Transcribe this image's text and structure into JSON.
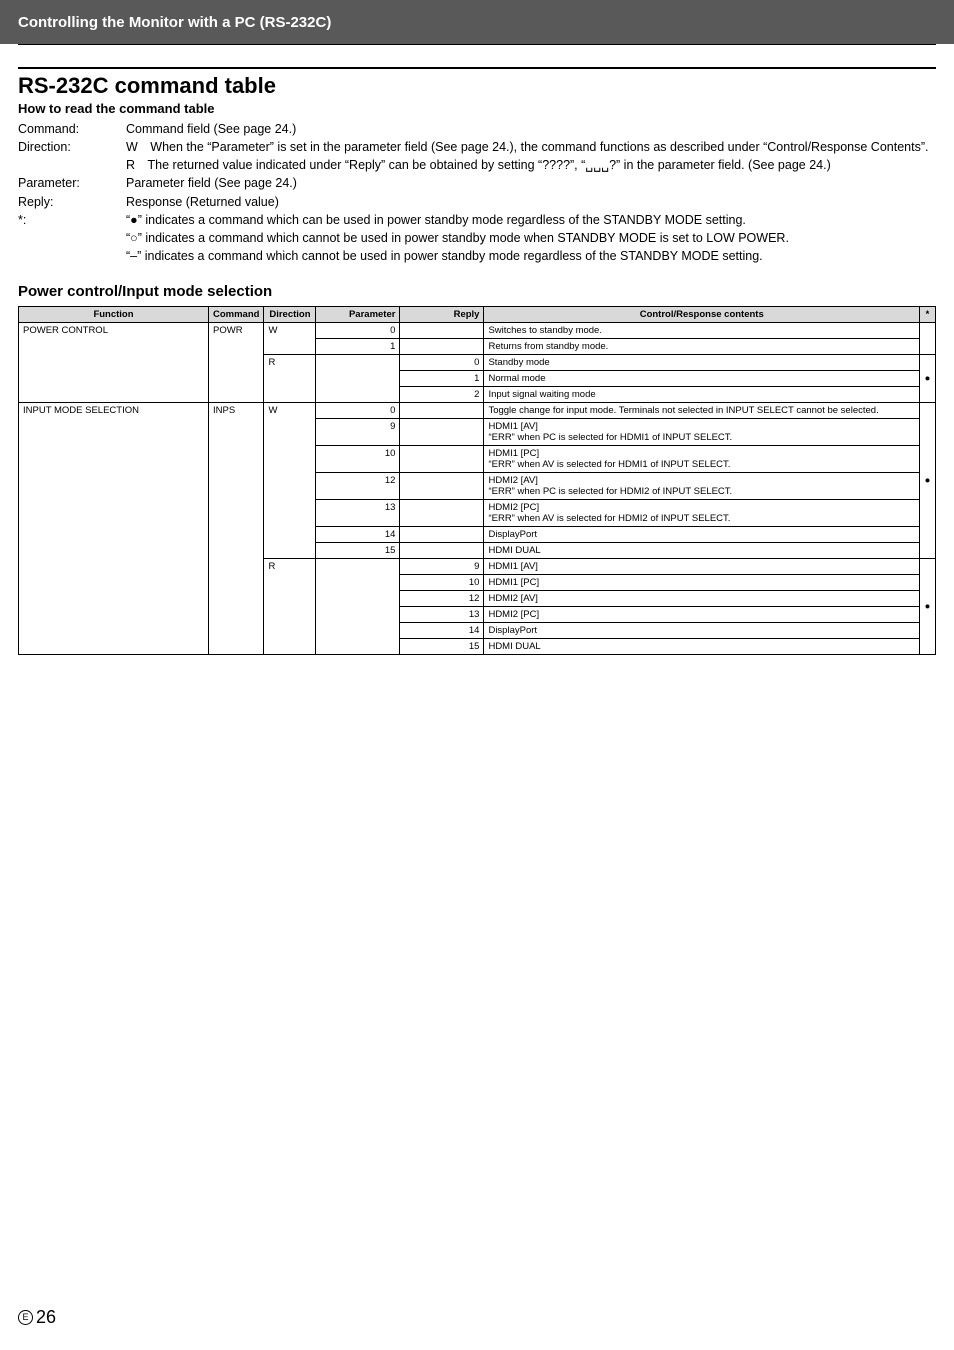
{
  "topbar": {
    "title": "Controlling the Monitor with a PC (RS-232C)"
  },
  "section_title": "RS-232C command table",
  "howto": {
    "heading": "How to read the command table",
    "rows": [
      {
        "k": "Command:",
        "v": "Command field (See page 24.)"
      },
      {
        "k": "Direction:",
        "v": "W When the “Parameter” is set in the parameter field (See page 24.), the command functions as described under “Control/Response Contents”."
      },
      {
        "k": "",
        "v": "R The returned value indicated under “Reply” can be obtained by setting “????”, “␣␣␣?” in the parameter field. (See page 24.)"
      },
      {
        "k": "Parameter:",
        "v": "Parameter field (See page 24.)"
      },
      {
        "k": "Reply:",
        "v": "Response (Returned value)"
      },
      {
        "k": "*:",
        "v": "“●” indicates a command which can be used in power standby mode regardless of the STANDBY MODE setting."
      },
      {
        "k": "",
        "v": "“○” indicates a command which cannot be used in power standby mode when STANDBY MODE is set to LOW POWER."
      },
      {
        "k": "",
        "v": "“–” indicates a command which cannot be used in power standby mode regardless of the STANDBY MODE setting."
      }
    ]
  },
  "pmc": {
    "heading": "Power control/Input mode selection",
    "headers": {
      "func": "Function",
      "cmd": "Command",
      "dir": "Direction",
      "par": "Parameter",
      "rep": "Reply",
      "cont": "Control/Response contents",
      "star": "*"
    }
  },
  "chart_data": {
    "type": "table",
    "title": "Power control/Input mode selection",
    "columns": [
      "Function",
      "Command",
      "Direction",
      "Parameter",
      "Reply",
      "Control/Response contents",
      "*"
    ],
    "groups": [
      {
        "function": "POWER CONTROL",
        "command": "POWR",
        "blocks": [
          {
            "direction": "W",
            "star": "",
            "rows": [
              {
                "parameter": "0",
                "reply": "",
                "contents": "Switches to standby mode."
              },
              {
                "parameter": "1",
                "reply": "",
                "contents": "Returns from standby mode."
              }
            ]
          },
          {
            "direction": "R",
            "star": "●",
            "rows": [
              {
                "parameter": "",
                "reply": "0",
                "contents": "Standby mode"
              },
              {
                "parameter": "",
                "reply": "1",
                "contents": "Normal mode"
              },
              {
                "parameter": "",
                "reply": "2",
                "contents": "Input signal waiting mode"
              }
            ]
          }
        ]
      },
      {
        "function": "INPUT MODE SELECTION",
        "command": "INPS",
        "blocks": [
          {
            "direction": "W",
            "star": "●",
            "rows": [
              {
                "parameter": "0",
                "reply": "",
                "contents": "Toggle change for input mode. Terminals not selected in INPUT SELECT cannot be selected."
              },
              {
                "parameter": "9",
                "reply": "",
                "contents": "HDMI1 [AV]\n“ERR” when PC is selected for HDMI1 of INPUT SELECT."
              },
              {
                "parameter": "10",
                "reply": "",
                "contents": "HDMI1 [PC]\n“ERR” when AV is selected for HDMI1 of INPUT SELECT."
              },
              {
                "parameter": "12",
                "reply": "",
                "contents": "HDMI2 [AV]\n“ERR” when PC is selected for HDMI2 of INPUT SELECT."
              },
              {
                "parameter": "13",
                "reply": "",
                "contents": "HDMI2 [PC]\n“ERR” when AV is selected for HDMI2 of INPUT SELECT."
              },
              {
                "parameter": "14",
                "reply": "",
                "contents": "DisplayPort"
              },
              {
                "parameter": "15",
                "reply": "",
                "contents": "HDMI DUAL"
              }
            ]
          },
          {
            "direction": "R",
            "star": "●",
            "rows": [
              {
                "parameter": "",
                "reply": "9",
                "contents": "HDMI1 [AV]"
              },
              {
                "parameter": "",
                "reply": "10",
                "contents": "HDMI1 [PC]"
              },
              {
                "parameter": "",
                "reply": "12",
                "contents": "HDMI2 [AV]"
              },
              {
                "parameter": "",
                "reply": "13",
                "contents": "HDMI2 [PC]"
              },
              {
                "parameter": "",
                "reply": "14",
                "contents": "DisplayPort"
              },
              {
                "parameter": "",
                "reply": "15",
                "contents": "HDMI DUAL"
              }
            ]
          }
        ]
      }
    ]
  },
  "footer": {
    "lang": "E",
    "page": "26"
  }
}
